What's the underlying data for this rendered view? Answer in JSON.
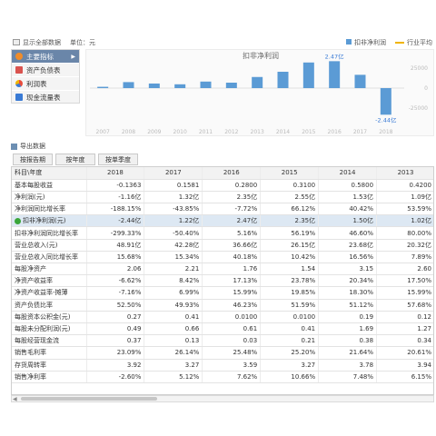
{
  "topbar": {
    "show_all_label": "显示全部数据",
    "unit_label": "单位：元",
    "legend_bar": "扣非净利润",
    "legend_line": "行业平均"
  },
  "sidebar": {
    "items": [
      {
        "label": "主要指标",
        "icon": "indicator-icon",
        "active": true
      },
      {
        "label": "资产负债表",
        "icon": "balance-sheet-icon",
        "active": false
      },
      {
        "label": "利润表",
        "icon": "income-statement-icon",
        "active": false
      },
      {
        "label": "现金流量表",
        "icon": "cash-flow-icon",
        "active": false
      }
    ]
  },
  "chart_data": {
    "type": "bar",
    "title": "扣非净利润",
    "categories": [
      "2007",
      "2008",
      "2009",
      "2010",
      "2011",
      "2012",
      "2013",
      "2014",
      "2015",
      "2016",
      "2017",
      "2018"
    ],
    "series": [
      {
        "name": "扣非净利润",
        "values": [
          0.12,
          0.55,
          0.42,
          0.35,
          0.6,
          0.5,
          1.02,
          1.5,
          2.35,
          2.47,
          1.22,
          -2.44
        ],
        "color": "#5b9bd5"
      }
    ],
    "annotations": [
      {
        "category": "2016",
        "text": "2.47亿"
      },
      {
        "category": "2018",
        "text": "-2.44亿"
      }
    ],
    "y_ticks": [
      "25000",
      "0",
      "-25000"
    ],
    "ylim": [
      -3,
      3
    ],
    "grid": false
  },
  "export_label": "导出数据",
  "tabs": [
    "按报告期",
    "按年度",
    "按单季度"
  ],
  "table": {
    "header_label": "科目\\年度",
    "years": [
      "2018",
      "2017",
      "2016",
      "2015",
      "2014",
      "2013"
    ],
    "rows": [
      {
        "label": "基本每股收益",
        "values": [
          "-0.1363",
          "0.1581",
          "0.2800",
          "0.3100",
          "0.5800",
          "0.4200"
        ]
      },
      {
        "label": "净利润(元)",
        "values": [
          "-1.16亿",
          "1.32亿",
          "2.35亿",
          "2.55亿",
          "1.53亿",
          "1.09亿"
        ]
      },
      {
        "label": "净利润同比增长率",
        "values": [
          "-188.15%",
          "-43.85%",
          "-7.72%",
          "66.12%",
          "40.42%",
          "53.59%"
        ]
      },
      {
        "label": "扣非净利润(元)",
        "values": [
          "-2.44亿",
          "1.22亿",
          "2.47亿",
          "2.35亿",
          "1.50亿",
          "1.02亿"
        ],
        "highlight": true
      },
      {
        "label": "扣非净利润同比增长率",
        "values": [
          "-299.33%",
          "-50.40%",
          "5.16%",
          "56.19%",
          "46.60%",
          "80.00%"
        ]
      },
      {
        "label": "营业总收入(元)",
        "values": [
          "48.91亿",
          "42.28亿",
          "36.66亿",
          "26.15亿",
          "23.68亿",
          "20.32亿"
        ]
      },
      {
        "label": "营业总收入同比增长率",
        "values": [
          "15.68%",
          "15.34%",
          "40.18%",
          "10.42%",
          "16.56%",
          "7.89%"
        ]
      },
      {
        "label": "每股净资产",
        "values": [
          "2.06",
          "2.21",
          "1.76",
          "1.54",
          "3.15",
          "2.60"
        ]
      },
      {
        "label": "净资产收益率",
        "values": [
          "-6.62%",
          "8.42%",
          "17.13%",
          "23.78%",
          "20.34%",
          "17.50%"
        ]
      },
      {
        "label": "净资产收益率-摊薄",
        "values": [
          "-7.16%",
          "6.99%",
          "15.99%",
          "19.85%",
          "18.30%",
          "15.99%"
        ]
      },
      {
        "label": "资产负债比率",
        "values": [
          "52.50%",
          "49.93%",
          "46.23%",
          "51.59%",
          "51.12%",
          "57.68%"
        ]
      },
      {
        "label": "每股资本公积金(元)",
        "values": [
          "0.27",
          "0.41",
          "0.0100",
          "0.0100",
          "0.19",
          "0.12"
        ]
      },
      {
        "label": "每股未分配利润(元)",
        "values": [
          "0.49",
          "0.66",
          "0.61",
          "0.41",
          "1.69",
          "1.27"
        ]
      },
      {
        "label": "每股经营现金流",
        "values": [
          "0.37",
          "0.13",
          "0.03",
          "0.21",
          "0.38",
          "0.34"
        ]
      },
      {
        "label": "销售毛利率",
        "values": [
          "23.09%",
          "26.14%",
          "25.48%",
          "25.20%",
          "21.64%",
          "20.61%"
        ]
      },
      {
        "label": "存货周转率",
        "values": [
          "3.92",
          "3.27",
          "3.59",
          "3.27",
          "3.78",
          "3.94"
        ]
      },
      {
        "label": "销售净利率",
        "values": [
          "-2.60%",
          "5.12%",
          "7.62%",
          "10.66%",
          "7.48%",
          "6.15%"
        ]
      }
    ]
  }
}
